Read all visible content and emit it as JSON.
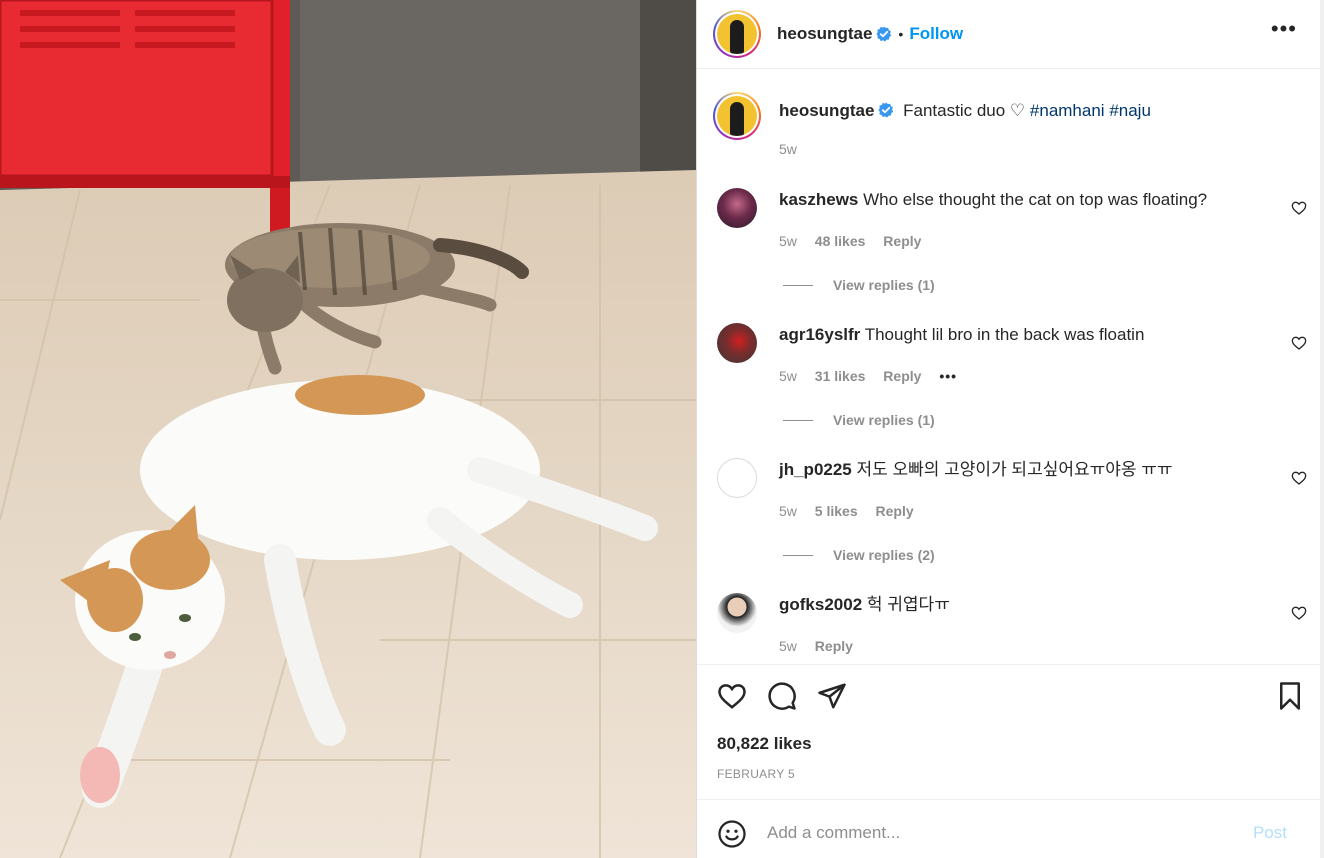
{
  "post": {
    "username": "heosungtae",
    "follow_label": "Follow",
    "separator": "•",
    "more_label": "•••"
  },
  "caption": {
    "username": "heosungtae",
    "text": "Fantastic duo ♡",
    "hashtags": [
      "#namhani",
      "#naju"
    ],
    "time": "5w"
  },
  "comments": [
    {
      "username": "kaszhews",
      "text": "Who else thought the cat on top was floating?",
      "time": "5w",
      "likes": "48 likes",
      "reply_label": "Reply",
      "view_replies": "View replies (1)"
    },
    {
      "username": "agr16yslfr",
      "text": "Thought lil bro in the back was floatin",
      "time": "5w",
      "likes": "31 likes",
      "reply_label": "Reply",
      "more_label": "•••",
      "view_replies": "View replies (1)"
    },
    {
      "username": "jh_p0225",
      "text": "저도 오빠의 고양이가 되고싶어요ㅠ야옹 ㅠㅠ",
      "time": "5w",
      "likes": "5 likes",
      "reply_label": "Reply",
      "view_replies": "View replies (2)"
    },
    {
      "username": "gofks2002",
      "text": "헉 귀엽다ㅠ",
      "time": "5w",
      "reply_label": "Reply"
    }
  ],
  "footer": {
    "likes": "80,822 likes",
    "date": "FEBRUARY 5",
    "comment_placeholder": "Add a comment...",
    "post_label": "Post"
  },
  "icons": {
    "verified": "verified-badge-icon",
    "like": "heart-icon",
    "comment": "comment-bubble-icon",
    "share": "paper-plane-icon",
    "save": "bookmark-icon",
    "emoji": "smiley-icon"
  },
  "colors": {
    "link": "#0095f6",
    "hashtag": "#00376b",
    "muted": "#8e8e8e",
    "post_disabled": "#b2dffc"
  }
}
